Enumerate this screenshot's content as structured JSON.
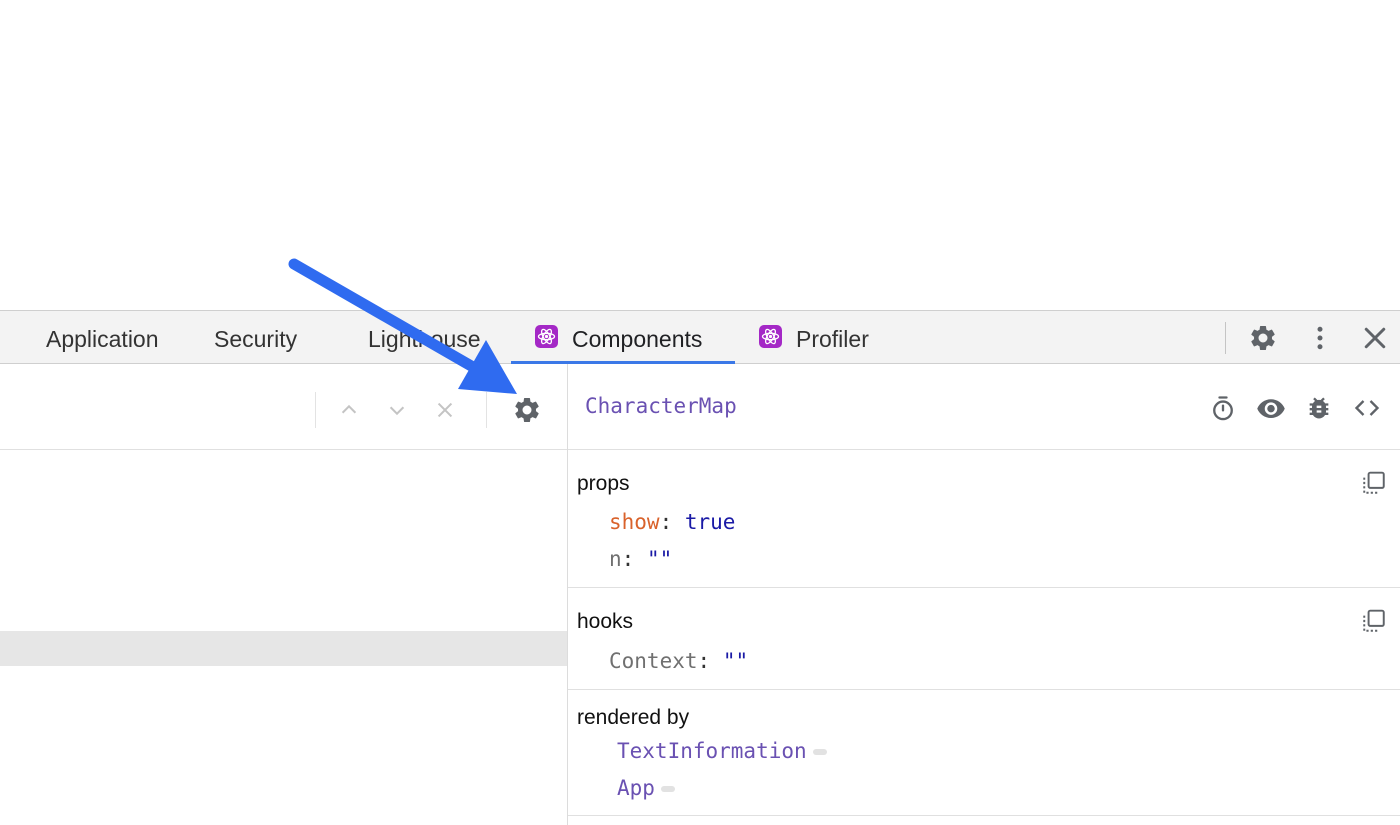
{
  "tabs": [
    {
      "label": "Application",
      "react": false,
      "active": false
    },
    {
      "label": "Security",
      "react": false,
      "active": false
    },
    {
      "label": "Lighthouse",
      "react": false,
      "active": false
    },
    {
      "label": "Components",
      "react": true,
      "active": true
    },
    {
      "label": "Profiler",
      "react": true,
      "active": false
    }
  ],
  "tabbar_icons": [
    "gear-icon",
    "more-vertical-icon",
    "close-icon"
  ],
  "left_toolbar_icons": [
    "chevron-up-icon",
    "chevron-down-icon",
    "close-icon",
    "gear-icon"
  ],
  "colors": {
    "active_tab_underline": "#3b78e7",
    "react_badge": "#a428c6",
    "component_name": "#6a51b2",
    "changed_key": "#d9622b",
    "value": "#1a1aa6",
    "annotation_arrow": "#2f6bf0"
  },
  "inspector": {
    "component_name": "CharacterMap",
    "header_icons": [
      "stopwatch-icon",
      "eye-icon",
      "bug-icon",
      "code-icon"
    ],
    "props": {
      "title": "props",
      "items": [
        {
          "key": "show",
          "value": "true",
          "changed": true
        },
        {
          "key": "n",
          "value": "\"\"",
          "changed": false
        }
      ]
    },
    "hooks": {
      "title": "hooks",
      "items": [
        {
          "key": "Context",
          "value": "\"\""
        }
      ]
    },
    "rendered_by": {
      "title": "rendered by",
      "items": [
        "TextInformation",
        "App"
      ]
    }
  }
}
